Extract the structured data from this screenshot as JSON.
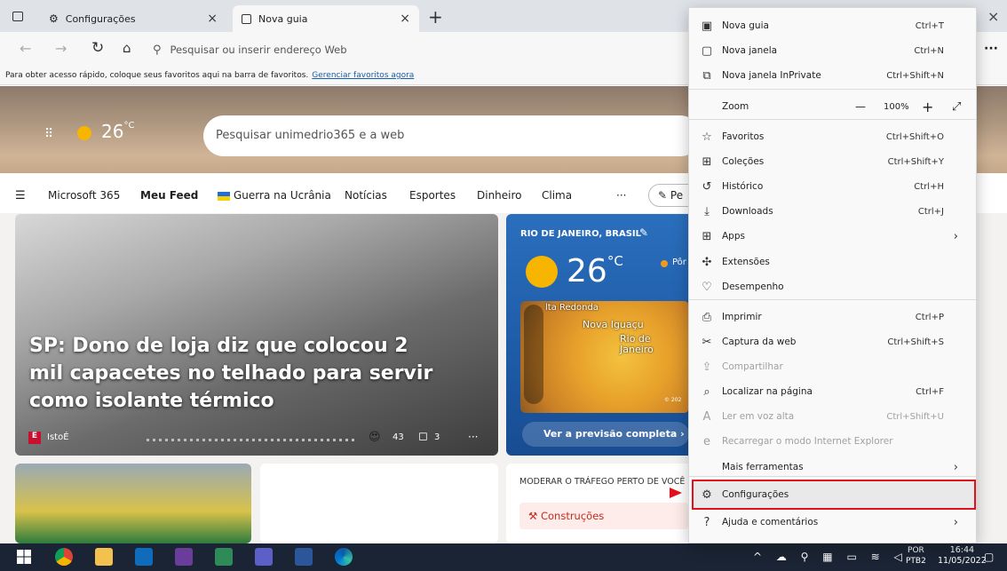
{
  "tabs": [
    {
      "title": "Configurações",
      "close": "×"
    },
    {
      "title": "Nova guia",
      "close": "×"
    }
  ],
  "new_tab_plus": "+",
  "window_close": "×",
  "address": {
    "placeholder": "Pesquisar ou inserir endereço Web"
  },
  "favbar": {
    "text": "Para obter acesso rápido, coloque seus favoritos aqui na barra de favoritos.",
    "link": "Gerenciar favoritos agora"
  },
  "weather": {
    "temp": "26",
    "unit": "°C"
  },
  "search": {
    "placeholder": "Pesquisar unimedrio365 e a web"
  },
  "nav": [
    "Microsoft 365",
    "Meu Feed",
    "Guerra na Ucrânia",
    "Notícias",
    "Esportes",
    "Dinheiro",
    "Clima",
    "···",
    "Pe"
  ],
  "card1": {
    "headline": "SP: Dono de loja diz que colocou 2 mil capacetes no telhado para servir como isolante térmico",
    "source": "IstoÉ",
    "reactions": "43",
    "comments": "3",
    "more": "···"
  },
  "card2": {
    "location": "RIO DE JANEIRO, BRASIL",
    "temp": "26",
    "unit": "°C",
    "side": "Pôr",
    "map_labels": [
      "lta Redonda",
      "Nova Iguaçu",
      "Rio de",
      "Janeiro"
    ],
    "map_footer": "© 202",
    "cta": "Ver a previsão completa"
  },
  "bottom_card": {
    "title": "MODERAR O TRÁFEGO PERTO DE VOCÊ",
    "item": "Construções"
  },
  "menu": {
    "items": [
      {
        "icon": "new-tab-icon",
        "label": "Nova guia",
        "shortcut": "Ctrl+T"
      },
      {
        "icon": "new-window-icon",
        "label": "Nova janela",
        "shortcut": "Ctrl+N"
      },
      {
        "icon": "inprivate-icon",
        "label": "Nova janela InPrivate",
        "shortcut": "Ctrl+Shift+N"
      },
      {
        "icon": "favorites-icon",
        "label": "Favoritos",
        "shortcut": "Ctrl+Shift+O"
      },
      {
        "icon": "collections-icon",
        "label": "Coleções",
        "shortcut": "Ctrl+Shift+Y"
      },
      {
        "icon": "history-icon",
        "label": "Histórico",
        "shortcut": "Ctrl+H"
      },
      {
        "icon": "downloads-icon",
        "label": "Downloads",
        "shortcut": "Ctrl+J"
      },
      {
        "icon": "apps-icon",
        "label": "Apps",
        "shortcut": ""
      },
      {
        "icon": "extensions-icon",
        "label": "Extensões",
        "shortcut": ""
      },
      {
        "icon": "performance-icon",
        "label": "Desempenho",
        "shortcut": ""
      },
      {
        "icon": "print-icon",
        "label": "Imprimir",
        "shortcut": "Ctrl+P"
      },
      {
        "icon": "web-capture-icon",
        "label": "Captura da web",
        "shortcut": "Ctrl+Shift+S"
      },
      {
        "icon": "share-icon",
        "label": "Compartilhar",
        "shortcut": ""
      },
      {
        "icon": "find-icon",
        "label": "Localizar na página",
        "shortcut": "Ctrl+F"
      },
      {
        "icon": "read-aloud-icon",
        "label": "Ler em voz alta",
        "shortcut": "Ctrl+Shift+U"
      },
      {
        "icon": "ie-mode-icon",
        "label": "Recarregar o modo Internet Explorer",
        "shortcut": ""
      },
      {
        "icon": "",
        "label": "Mais ferramentas",
        "shortcut": ""
      },
      {
        "icon": "settings-icon",
        "label": "Configurações",
        "shortcut": ""
      },
      {
        "icon": "help-icon",
        "label": "Ajuda e comentários",
        "shortcut": ""
      }
    ],
    "zoom": {
      "label": "Zoom",
      "minus": "—",
      "value": "100%",
      "plus": "+"
    }
  },
  "taskbar": {
    "lang1": "POR",
    "lang2": "PTB2",
    "time": "16:44",
    "date": "11/05/2022"
  },
  "colors": {
    "highlight": "#e0101c",
    "taskbar": "#1b2434"
  }
}
